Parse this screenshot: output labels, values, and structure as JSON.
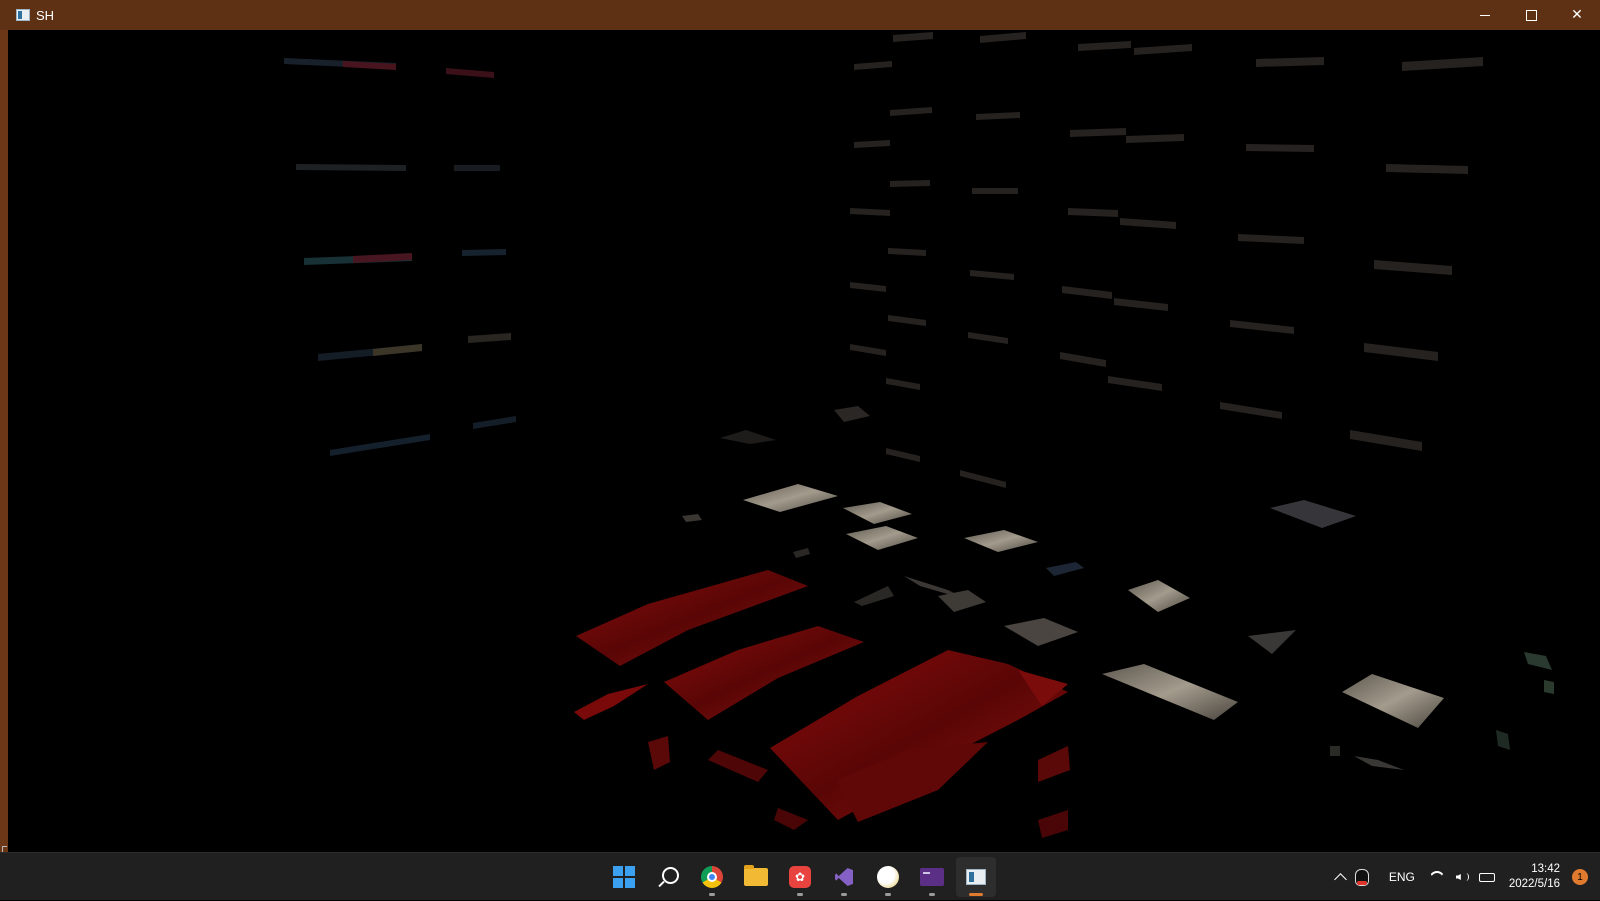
{
  "window": {
    "title": "SH",
    "controls": {
      "minimize": "",
      "maximize": "",
      "close": "✕"
    }
  },
  "taskbar": {
    "apps": [
      {
        "name": "start-button",
        "icon": "windows-start-icon",
        "active": false,
        "running": false
      },
      {
        "name": "search-button",
        "icon": "search-icon",
        "active": false,
        "running": false
      },
      {
        "name": "chrome",
        "icon": "chrome-icon",
        "active": false,
        "running": true
      },
      {
        "name": "file-explorer",
        "icon": "folder-icon",
        "active": false,
        "running": false
      },
      {
        "name": "red-app",
        "icon": "red-app-icon",
        "active": false,
        "running": true
      },
      {
        "name": "visual-studio",
        "icon": "visual-studio-icon",
        "active": false,
        "running": true
      },
      {
        "name": "moon-app",
        "icon": "moon-icon",
        "active": false,
        "running": true
      },
      {
        "name": "terminal",
        "icon": "terminal-icon",
        "active": false,
        "running": true
      },
      {
        "name": "sh-app",
        "icon": "sh-window-icon",
        "active": true,
        "running": true
      }
    ],
    "tray": {
      "language": "ENG",
      "time": "13:42",
      "date": "2022/5/16",
      "notification_count": "1"
    }
  },
  "scene": {
    "description_colors": {
      "floor_red": "#6e0a0a",
      "tile_light": "#8c8478",
      "title_bar": "#5e3014",
      "taskbar": "#202020"
    }
  }
}
